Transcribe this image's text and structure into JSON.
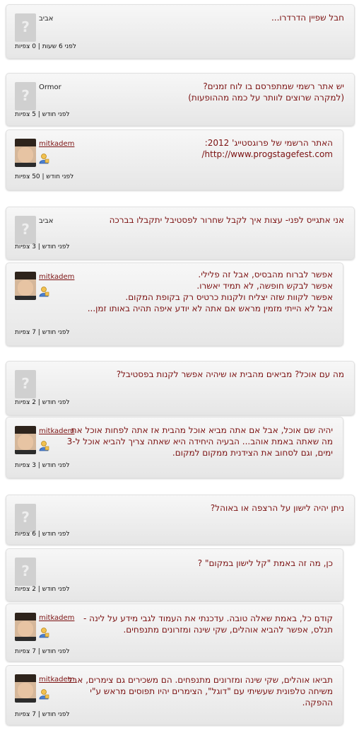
{
  "posts": [
    {
      "author": "אביב",
      "text": [
        "חבל שפיין הדרדרו..."
      ],
      "meta": "לפני 6 שעות | 0 צפיות"
    },
    {
      "author": "Ormor",
      "text": [
        "יש אתר רשמי שמתפרסם בו לוח זמנים?",
        "(למקרה שרוצים לוותר על כמה מההופעות)"
      ],
      "meta": "לפני חודש | 5 צפיות"
    },
    {
      "author": "mitkadem",
      "text": [
        "האתר הרשמי של פרוגסטייג' 2012:",
        "http://www.progstagefest.com/"
      ],
      "meta": "לפני חודש | 50 צפיות"
    },
    {
      "author": "אביב",
      "text": [
        "אני אתגייס לפני- עצות איך לקבל שחרור לפסטיבל יתקבלו בברכה"
      ],
      "meta": "לפני חודש | 3 צפיות"
    },
    {
      "author": "mitkadem",
      "text": [
        "אפשר לברוח מהבסיס, אבל זה פלילי.",
        "אפשר לבקש חופשה, לא תמיד יאשרו.",
        "אפשר לקוות שזה יצליח ולקנות כרטיס רק בקופת המקום.",
        "אבל לא הייתי מזמין מראש אם אתה לא יודע איפה תהיה באותו זמן..."
      ],
      "meta": "לפני חודש | 7 צפיות"
    },
    {
      "author": "",
      "text": [
        "מה עם אוכל? מביאים מהבית או שיהיה אפשר לקנות בפסטיבל?"
      ],
      "meta": "לפני חודש | 2 צפיות"
    },
    {
      "author": "mitkadem",
      "text": [
        "יהיה שם אוכל, אבל אם אתה מביא אוכל מהבית אז אתה לפחות אוכל את",
        "מה שאתה באמת אוהב... הבעיה היחידה היא שאתה צריך להביא אוכל ל-3",
        "ימים, וגם לסחוב את הצידנית ממקום למקום."
      ],
      "meta": "לפני חודש | 3 צפיות"
    },
    {
      "author": "",
      "text": [
        "ניתן יהיה לישון על הרצפה או באוהל?"
      ],
      "meta": "לפני חודש | 6 צפיות"
    },
    {
      "author": "",
      "text": [
        "כן, מה זה באמת \"קל לישון במקום\" ?"
      ],
      "meta": "לפני חודש | 2 צפיות"
    },
    {
      "author": "mitkadem",
      "text": [
        "קודם כל, באמת שאלה טובה. עדכנתי את העמוד לגבי מידע על לינה -",
        "תנלס, אפשר להביא אוהלים, שקי שינה ומזרונים מתנפחים."
      ],
      "meta": "לפני חודש | 7 צפיות"
    },
    {
      "author": "mitkadem",
      "text": [
        "תביאו אוהלים, שקי שינה ומזרונים מתנפחים. הם משכירים גם צימרים, אבל",
        "משיחה טלפונית שעשיתי עם \"דוגל\", הצימרים יהיו תפוסים מראש ע\"י",
        "ההפקה."
      ],
      "meta": "לפני חודש | 7 צפיות"
    }
  ]
}
